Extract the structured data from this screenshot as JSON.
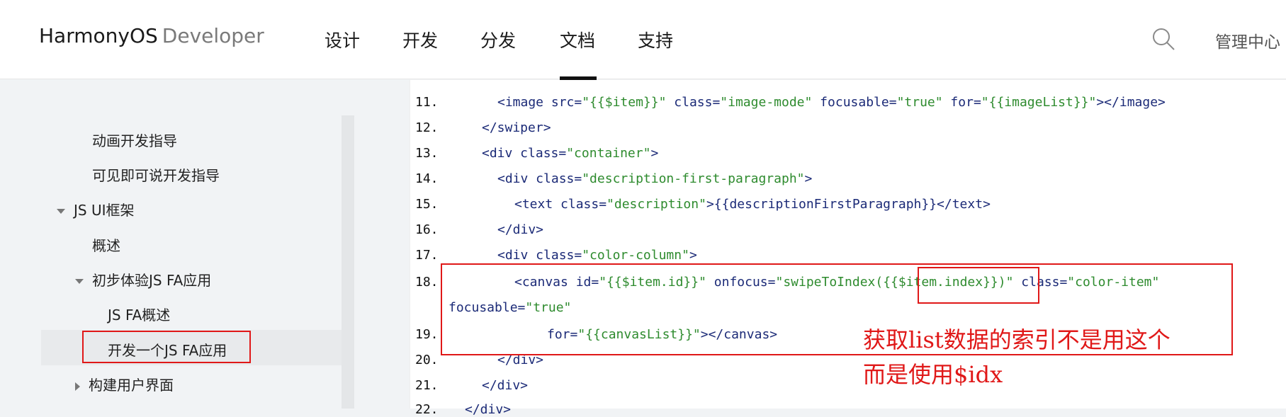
{
  "header": {
    "brand_main": "HarmonyOS",
    "brand_sub": "Developer",
    "nav": [
      "设计",
      "开发",
      "分发",
      "文档",
      "支持"
    ],
    "active_nav": "文档",
    "admin_label": "管理中心"
  },
  "sidebar": {
    "items": [
      {
        "label": "动画开发指导",
        "level": 2,
        "expander": "none"
      },
      {
        "label": "可见即可说开发指导",
        "level": 2,
        "expander": "none"
      },
      {
        "label": "JS UI框架",
        "level": 1,
        "expander": "expanded"
      },
      {
        "label": "概述",
        "level": 2,
        "expander": "none"
      },
      {
        "label": "初步体验JS FA应用",
        "level": 2,
        "expander": "expanded"
      },
      {
        "label": "JS FA概述",
        "level": 3,
        "expander": "none"
      },
      {
        "label": "开发一个JS FA应用",
        "level": 3,
        "expander": "none",
        "active": true
      },
      {
        "label": "构建用户界面",
        "level": 2,
        "expander": "collapsed"
      }
    ]
  },
  "code": {
    "lines": [
      {
        "n": "11.",
        "p1": "<image src=",
        "s1": "\"{{$item}}\"",
        "p2": " class=",
        "s2": "\"image-mode\"",
        "p3": " focusable=",
        "s3": "\"true\"",
        "p4": " for=",
        "s4": "\"{{imageList}}\"",
        "p5": "></image>"
      },
      {
        "n": "12.",
        "p1": "</swiper>"
      },
      {
        "n": "13.",
        "p1": "<div class=",
        "s1": "\"container\"",
        "p2": ">"
      },
      {
        "n": "14.",
        "p1": "<div class=",
        "s1": "\"description-first-paragraph\"",
        "p2": ">"
      },
      {
        "n": "15.",
        "p1": "<text class=",
        "s1": "\"description\"",
        "p2": ">{{descriptionFirstParagraph}}</text>"
      },
      {
        "n": "16.",
        "p1": "</div>"
      },
      {
        "n": "17.",
        "p1": "<div class=",
        "s1": "\"color-column\"",
        "p2": ">"
      },
      {
        "n": "18.",
        "p1": "<canvas id=",
        "s1": "\"{{$item.id}}\"",
        "p2": " onfocus=",
        "s2": "\"swipeToIndex({{$item.index}})\"",
        "p3": " class=",
        "s3": "\"color-item\""
      },
      {
        "n": "",
        "p1": "focusable=",
        "s1": "\"true\""
      },
      {
        "n": "19.",
        "p1": "for=",
        "s1": "\"{{canvasList}}\"",
        "p2": "></canvas>"
      },
      {
        "n": "20.",
        "p1": "</div>"
      },
      {
        "n": "21.",
        "p1": "</div>"
      },
      {
        "n": "22.",
        "p1": "</div>"
      }
    ]
  },
  "annotation": {
    "line1": "获取list数据的索引不是用这个",
    "line2": "而是使用$idx",
    "color": "#e01818"
  },
  "colors": {
    "tag": "#1b2a77",
    "string": "#2e8b2e",
    "highlight_box": "#e01818"
  }
}
